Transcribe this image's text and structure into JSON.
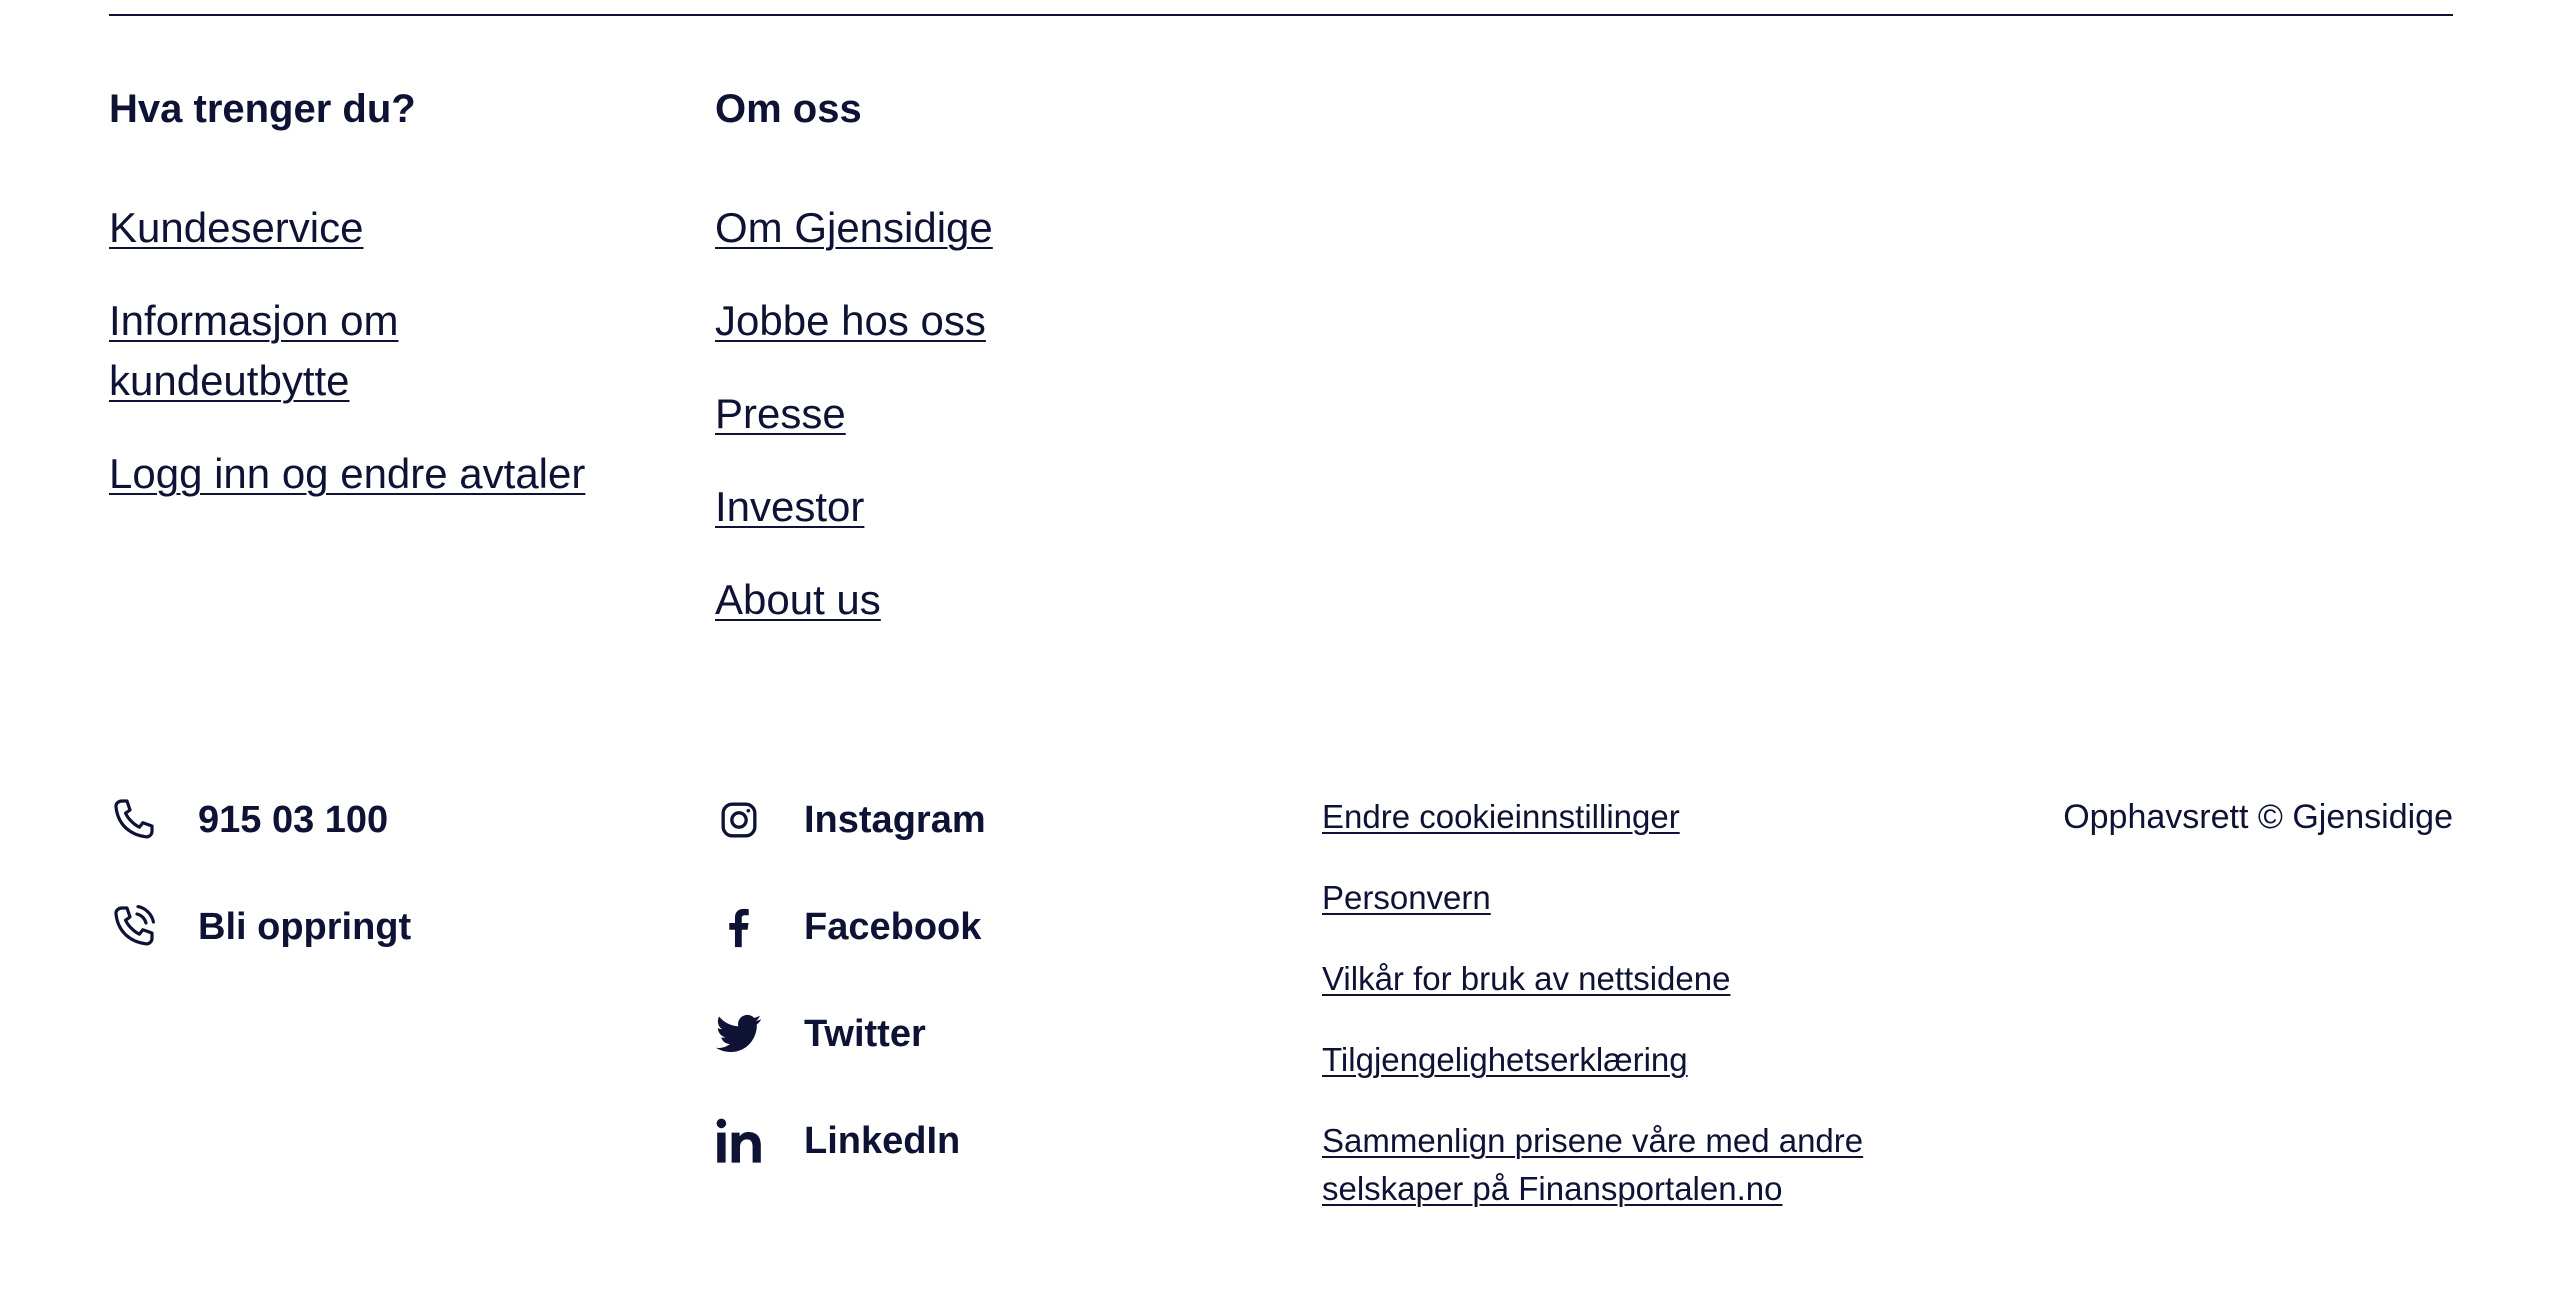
{
  "need_section": {
    "heading": "Hva trenger du?",
    "links": [
      "Kundeservice",
      "Informasjon om kundeutbytte",
      "Logg inn og endre avtaler"
    ]
  },
  "about_section": {
    "heading": "Om oss",
    "links": [
      "Om Gjensidige",
      "Jobbe hos oss",
      "Presse",
      "Investor",
      "About us"
    ]
  },
  "contact": {
    "phone": {
      "label": "915 03 100",
      "icon": "phone-icon"
    },
    "callback": {
      "label": "Bli oppringt",
      "icon": "phone-ringing-icon"
    }
  },
  "social": [
    {
      "label": "Instagram",
      "icon": "instagram-icon"
    },
    {
      "label": "Facebook",
      "icon": "facebook-icon"
    },
    {
      "label": "Twitter",
      "icon": "twitter-icon"
    },
    {
      "label": "LinkedIn",
      "icon": "linkedin-icon"
    }
  ],
  "legal_links": [
    "Endre cookieinnstillinger",
    "Personvern",
    "Vilkår for bruk av nettsidene",
    "Tilgjengelighetserklæring",
    "Sammenlign prisene våre med andre selskaper på Finansportalen.no"
  ],
  "copyright": "Opphavsrett © Gjensidige",
  "colors": {
    "text": "#0e1234",
    "background": "#ffffff"
  }
}
